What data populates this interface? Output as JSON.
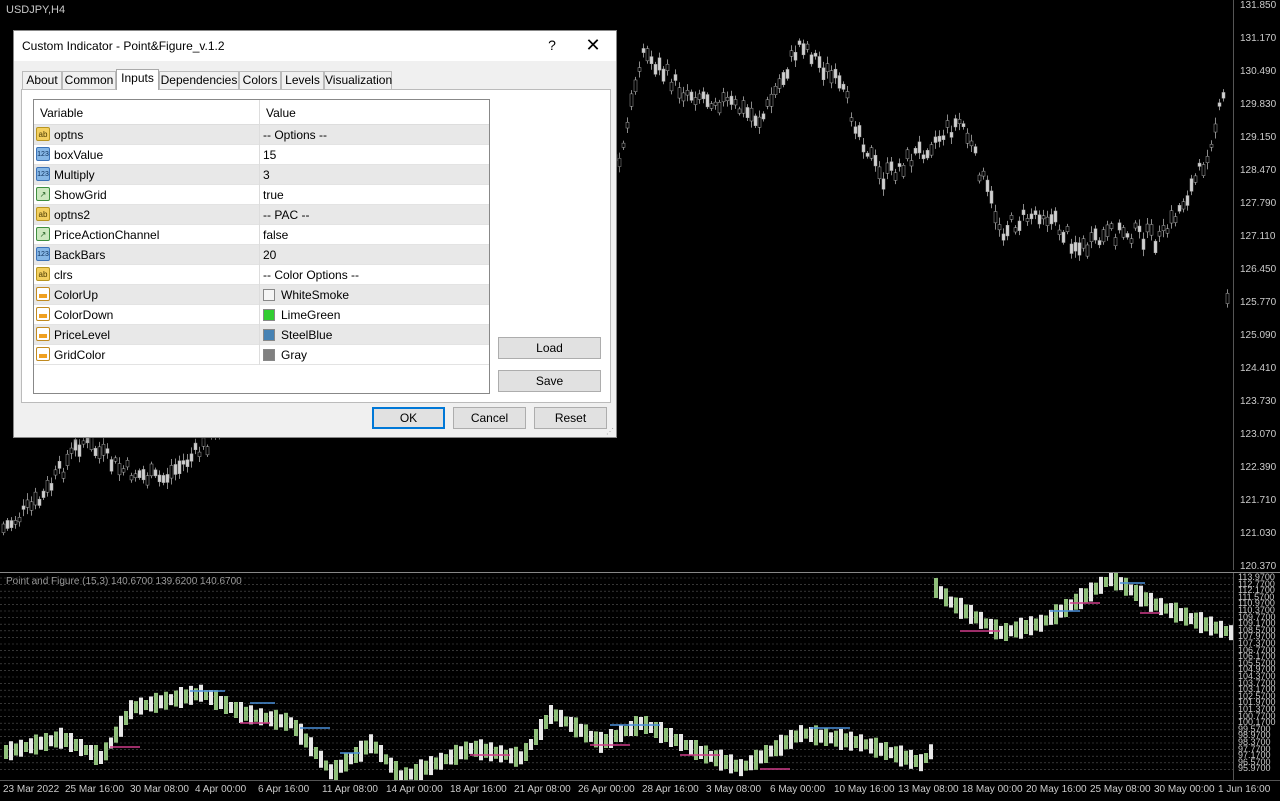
{
  "main_chart": {
    "symbol": "USDJPY,H4",
    "price_labels": [
      "131.850",
      "131.170",
      "130.490",
      "129.830",
      "129.150",
      "128.470",
      "127.790",
      "127.110",
      "126.450",
      "125.770",
      "125.090",
      "124.410",
      "123.730",
      "123.070",
      "122.390",
      "121.710",
      "121.030",
      "120.370"
    ]
  },
  "indicator": {
    "title": "Point and Figure (15,3) 140.6700 139.6200 140.6700",
    "labels": [
      "113.9700",
      "112.7700",
      "112.1700",
      "111.5700",
      "110.9700",
      "110.3700",
      "109.7700",
      "109.1700",
      "108.5700",
      "107.9700",
      "107.3700",
      "106.7700",
      "106.1700",
      "105.5700",
      "104.9700",
      "104.3700",
      "103.7700",
      "103.1700",
      "102.5700",
      "101.9700",
      "101.3700",
      "100.7700",
      "100.1700",
      "99.5700",
      "98.9700",
      "98.3700",
      "97.7700",
      "97.1700",
      "96.5700",
      "95.9700"
    ]
  },
  "time_axis": [
    "23 Mar 2022",
    "25 Mar 16:00",
    "30 Mar 08:00",
    "4 Apr 00:00",
    "6 Apr 16:00",
    "11 Apr 08:00",
    "14 Apr 00:00",
    "18 Apr 16:00",
    "21 Apr 08:00",
    "26 Apr 00:00",
    "28 Apr 16:00",
    "3 May 08:00",
    "6 May 00:00",
    "10 May 16:00",
    "13 May 08:00",
    "18 May 00:00",
    "20 May 16:00",
    "25 May 08:00",
    "30 May 00:00",
    "1 Jun 16:00"
  ],
  "dialog": {
    "title": "Custom Indicator - Point&Figure_v.1.2",
    "help": "?",
    "close": "✕",
    "tabs": [
      "About",
      "Common",
      "Inputs",
      "Dependencies",
      "Colors",
      "Levels",
      "Visualization"
    ],
    "active_tab": "Inputs",
    "columns": {
      "variable": "Variable",
      "value": "Value"
    },
    "rows": [
      {
        "icon": "ab",
        "icon_text": "ab",
        "variable": "optns",
        "value": "-- Options --"
      },
      {
        "icon": "num",
        "icon_text": "123",
        "variable": "boxValue",
        "value": "15"
      },
      {
        "icon": "num",
        "icon_text": "123",
        "variable": "Multiply",
        "value": "3"
      },
      {
        "icon": "bool",
        "icon_text": "↗",
        "variable": "ShowGrid",
        "value": "true"
      },
      {
        "icon": "ab",
        "icon_text": "ab",
        "variable": "optns2",
        "value": "-- PAC --"
      },
      {
        "icon": "bool",
        "icon_text": "↗",
        "variable": "PriceActionChannel",
        "value": "false"
      },
      {
        "icon": "num",
        "icon_text": "123",
        "variable": "BackBars",
        "value": "20"
      },
      {
        "icon": "ab",
        "icon_text": "ab",
        "variable": "clrs",
        "value": "-- Color Options --"
      },
      {
        "icon": "clr",
        "icon_text": "",
        "variable": "ColorUp",
        "value": "WhiteSmoke",
        "swatch": "#f5f5f5"
      },
      {
        "icon": "clr",
        "icon_text": "",
        "variable": "ColorDown",
        "value": "LimeGreen",
        "swatch": "#32cd32"
      },
      {
        "icon": "clr",
        "icon_text": "",
        "variable": "PriceLevel",
        "value": "SteelBlue",
        "swatch": "#4682b4"
      },
      {
        "icon": "clr",
        "icon_text": "",
        "variable": "GridColor",
        "value": "Gray",
        "swatch": "#808080"
      }
    ],
    "buttons": {
      "load": "Load",
      "save": "Save",
      "ok": "OK",
      "cancel": "Cancel",
      "reset": "Reset"
    }
  }
}
